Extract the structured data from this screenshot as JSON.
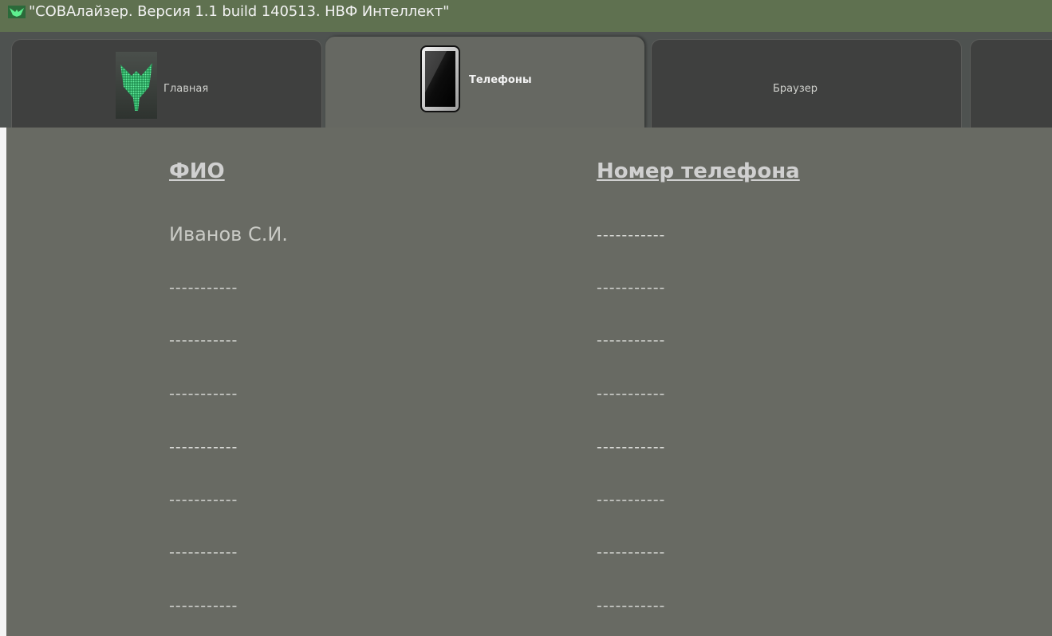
{
  "window": {
    "title": "\"СОВАлайзер. Версия 1.1 build 140513. НВФ Интеллект\""
  },
  "tabs": [
    {
      "label": "Главная",
      "icon": "owl-icon",
      "active": false
    },
    {
      "label": "Телефоны",
      "icon": "tablet-icon",
      "active": true
    },
    {
      "label": "Браузер",
      "icon": "",
      "active": false
    },
    {
      "label": "",
      "icon": "",
      "active": false
    }
  ],
  "table": {
    "columns": [
      "ФИО",
      "Номер телефона"
    ],
    "rows": [
      [
        "Иванов С.И.",
        "-----------"
      ],
      [
        "-----------",
        "-----------"
      ],
      [
        "-----------",
        "-----------"
      ],
      [
        "-----------",
        "-----------"
      ],
      [
        "-----------",
        "-----------"
      ],
      [
        "-----------",
        "-----------"
      ],
      [
        "-----------",
        "-----------"
      ],
      [
        "-----------",
        "-----------"
      ]
    ]
  },
  "colors": {
    "titlebar": "#5f7150",
    "background": "#686a63",
    "tab_inactive": "#3f403f",
    "accent_green": "#3ee07a"
  }
}
